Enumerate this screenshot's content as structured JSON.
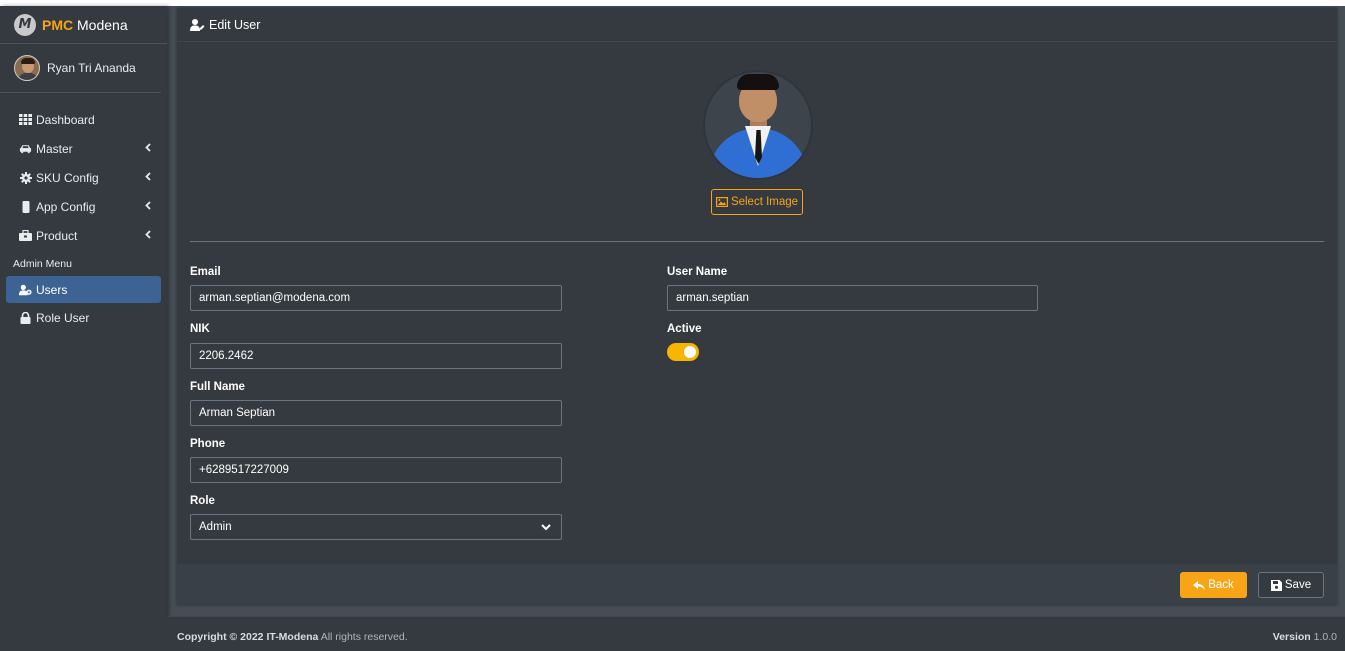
{
  "brand": {
    "strong": "PMC",
    "rest": " Modena",
    "logo_letter": "M"
  },
  "user": {
    "name": "Ryan Tri Ananda"
  },
  "sidebar": {
    "items": [
      {
        "label": "Dashboard",
        "icon": "grid-icon"
      },
      {
        "label": "Master",
        "icon": "car-icon"
      },
      {
        "label": "SKU Config",
        "icon": "gear-icon"
      },
      {
        "label": "App Config",
        "icon": "mobile-icon"
      },
      {
        "label": "Product",
        "icon": "toolbox-icon"
      }
    ],
    "header": "Admin Menu",
    "admin_items": [
      {
        "label": "Users",
        "icon": "users-icon",
        "active": true
      },
      {
        "label": "Role User",
        "icon": "lock-icon"
      }
    ]
  },
  "card": {
    "title": "Edit User",
    "select_image_label": "Select Image",
    "fields": {
      "email": {
        "label": "Email",
        "value": "arman.septian@modena.com"
      },
      "nik": {
        "label": "NIK",
        "value": "2206.2462"
      },
      "full_name": {
        "label": "Full Name",
        "value": "Arman Septian"
      },
      "phone": {
        "label": "Phone",
        "value": "+6289517227009"
      },
      "role": {
        "label": "Role",
        "value": "Admin"
      },
      "username": {
        "label": "User Name",
        "value": "arman.septian"
      },
      "active": {
        "label": "Active",
        "checked": true
      }
    },
    "back_label": "Back",
    "save_label": "Save"
  },
  "footer": {
    "copyright_prefix": "Copyright © 2022 ",
    "company": "IT-Modena",
    "rights": " All rights reserved.",
    "version_label": "Version",
    "version": " 1.0.0"
  },
  "colors": {
    "accent": "#f7a516",
    "active_nav": "#3c6393",
    "background": "#343a40"
  }
}
